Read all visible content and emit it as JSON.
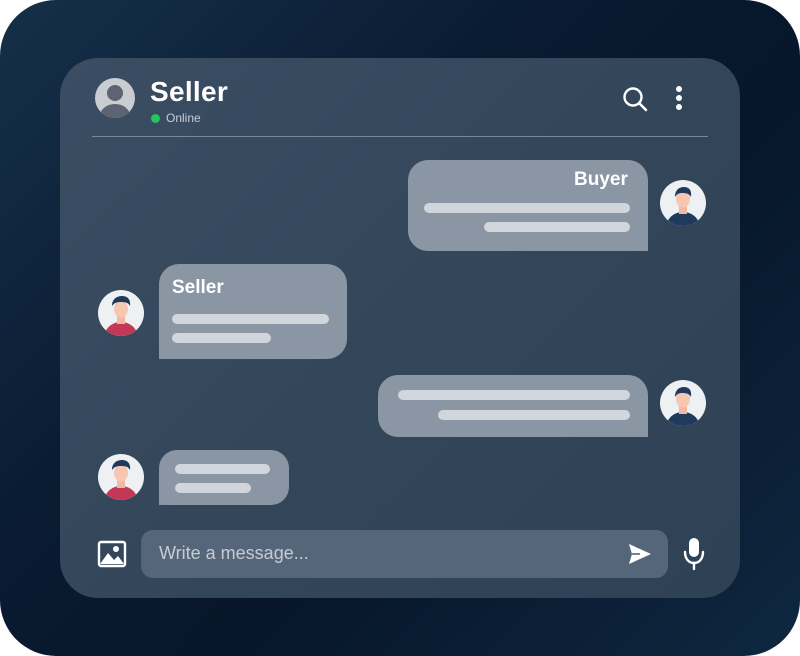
{
  "header": {
    "contact_name": "Seller",
    "status": "Online",
    "icons": [
      "user-icon",
      "search-icon",
      "more-vertical-icon"
    ]
  },
  "messages": [
    {
      "from": "Buyer",
      "side": "right",
      "label": "Buyer"
    },
    {
      "from": "Seller",
      "side": "left",
      "label": "Seller"
    },
    {
      "from": "Buyer",
      "side": "right",
      "label": ""
    },
    {
      "from": "Seller",
      "side": "left",
      "label": ""
    }
  ],
  "composer": {
    "placeholder": "Write a message...",
    "icons": [
      "image-icon",
      "send-icon",
      "microphone-icon"
    ]
  },
  "colors": {
    "online": "#22c55e",
    "buyer_shirt": "#1f3a5c",
    "seller_shirt": "#c23856"
  }
}
